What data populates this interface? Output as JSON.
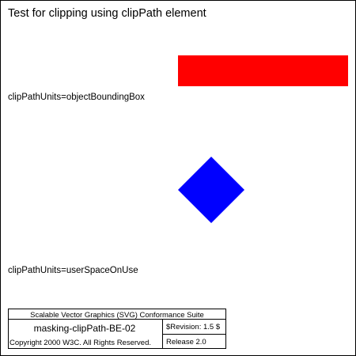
{
  "title": "Test for clipping using clipPath element",
  "label_object_bounding_box": "clipPathUnits=objectBoundingBox",
  "label_user_space_on_use": "clipPathUnits=userSpaceOnUse",
  "shape_colors": {
    "bar": "#ff0000",
    "diamond": "#0000ff"
  },
  "footer": {
    "suite": "Scalable Vector Graphics (SVG) Conformance Suite",
    "test_name": "masking-clipPath-BE-02",
    "revision": "$Revision: 1.5 $",
    "copyright": "Copyright 2000 W3C. All Rights Reserved.",
    "release": "Release 2.0",
    "copyright_color": "#2b2bd6"
  }
}
